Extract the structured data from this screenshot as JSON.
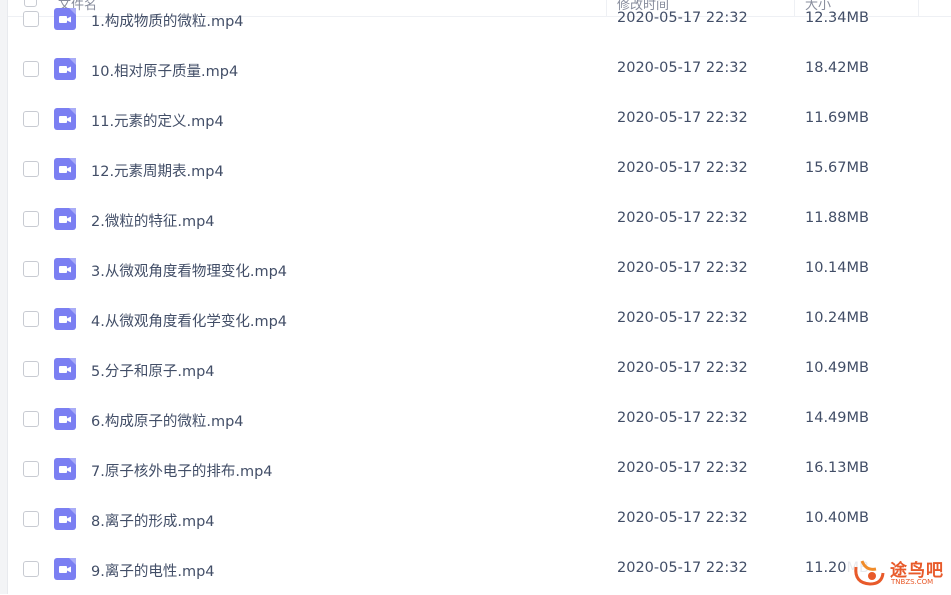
{
  "header": {
    "name_col": "文件名",
    "date_col": "修改时间",
    "size_col": "大小"
  },
  "accent_color": "#06a7ff",
  "file_icon_color": "#7b7ff2",
  "files": [
    {
      "name": "1.构成物质的微粒.mp4",
      "date": "2020-05-17 22:32",
      "size": "12.34MB"
    },
    {
      "name": "10.相对原子质量.mp4",
      "date": "2020-05-17 22:32",
      "size": "18.42MB"
    },
    {
      "name": "11.元素的定义.mp4",
      "date": "2020-05-17 22:32",
      "size": "11.69MB"
    },
    {
      "name": "12.元素周期表.mp4",
      "date": "2020-05-17 22:32",
      "size": "15.67MB"
    },
    {
      "name": "2.微粒的特征.mp4",
      "date": "2020-05-17 22:32",
      "size": "11.88MB"
    },
    {
      "name": "3.从微观角度看物理变化.mp4",
      "date": "2020-05-17 22:32",
      "size": "10.14MB"
    },
    {
      "name": "4.从微观角度看化学变化.mp4",
      "date": "2020-05-17 22:32",
      "size": "10.24MB"
    },
    {
      "name": "5.分子和原子.mp4",
      "date": "2020-05-17 22:32",
      "size": "10.49MB"
    },
    {
      "name": "6.构成原子的微粒.mp4",
      "date": "2020-05-17 22:32",
      "size": "14.49MB"
    },
    {
      "name": "7.原子核外电子的排布.mp4",
      "date": "2020-05-17 22:32",
      "size": "16.13MB"
    },
    {
      "name": "8.离子的形成.mp4",
      "date": "2020-05-17 22:32",
      "size": "10.40MB"
    },
    {
      "name": "9.离子的电性.mp4",
      "date": "2020-05-17 22:32",
      "size": "11.20MB"
    }
  ],
  "watermark": {
    "text": "途鸟吧",
    "sub": "TNBZS.COM"
  }
}
